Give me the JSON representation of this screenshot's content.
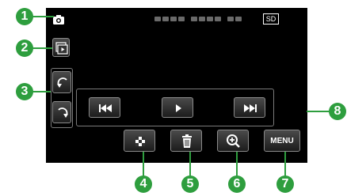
{
  "status": {
    "mode_icon": "camera-icon",
    "datetime_placeholder": "",
    "media_badge": "SD"
  },
  "sidebar": {
    "switch_icon": "playback-switch-icon",
    "rotate_left_icon": "rotate-left-icon",
    "rotate_right_icon": "rotate-right-icon"
  },
  "playback": {
    "prev_icon": "skip-previous-icon",
    "play_icon": "play-icon",
    "next_icon": "skip-next-icon"
  },
  "toolbar": {
    "index_icon": "index-grid-icon",
    "delete_icon": "trash-icon",
    "zoom_icon": "zoom-in-icon",
    "menu_label": "MENU"
  },
  "callouts": [
    "1",
    "2",
    "3",
    "4",
    "5",
    "6",
    "7",
    "8"
  ],
  "colors": {
    "screen_bg": "#000000",
    "callout_green": "#2e9e3e",
    "button_border": "#8a8a8a"
  }
}
